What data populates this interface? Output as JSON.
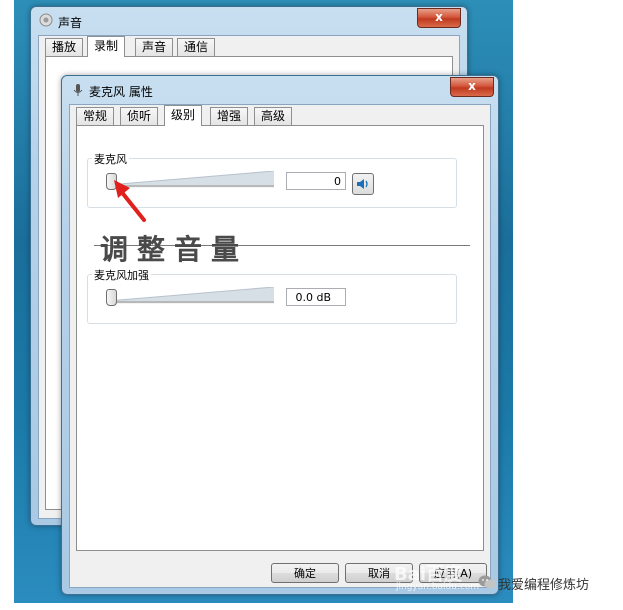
{
  "sound_window": {
    "title": "声音",
    "close_label": "x",
    "tabs": [
      "播放",
      "录制",
      "声音",
      "通信"
    ],
    "active_tab": "录制"
  },
  "properties_window": {
    "title": "麦克风 属性",
    "close_label": "x",
    "tabs": [
      "常规",
      "侦听",
      "级别",
      "增强",
      "高级"
    ],
    "active_tab": "级别",
    "microphone": {
      "label": "麦克风",
      "value": "0",
      "level_fraction": 0
    },
    "boost": {
      "label": "麦克风加强",
      "value": "0.0 dB",
      "level_fraction": 0
    },
    "buttons": {
      "ok": "确定",
      "cancel": "取消",
      "apply": "应用(A)"
    }
  },
  "annotation": {
    "caption": "调整音量",
    "arrow_color": "#e0201c"
  },
  "watermarks": {
    "baidu": "Bai百度",
    "jingyan": "jingyan.baidu.com",
    "wechat_account": "我爱编程修炼坊"
  },
  "colors": {
    "desktop": "#1a6e9a",
    "window_frame": "#b6d2ea",
    "close_button": "#c0391f",
    "speaker_icon": "#1f6fb8"
  }
}
